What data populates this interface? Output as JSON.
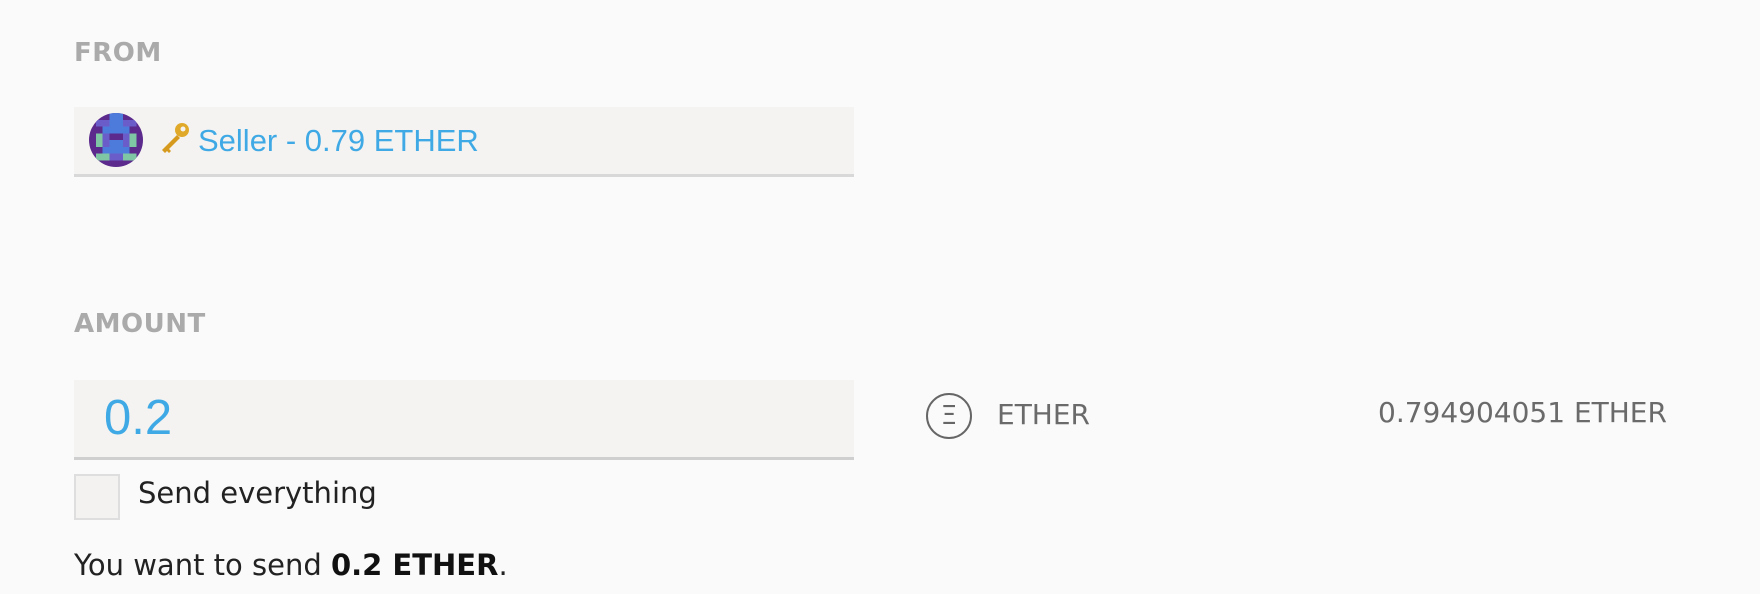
{
  "from": {
    "label": "FROM",
    "account_text": "Seller - 0.79 ETHER"
  },
  "amount": {
    "label": "AMOUNT",
    "value": "0.2",
    "currency_icon_glyph": "Ξ",
    "currency_name": "ETHER",
    "balance": "0.794904051 ETHER"
  },
  "send_everything": {
    "label": "Send everything",
    "checked": false
  },
  "summary": {
    "prefix": "You want to send ",
    "amount": "0.2 ETHER",
    "suffix": "."
  },
  "colors": {
    "accent": "#3fa9e5",
    "label_gray": "#aaaaaa",
    "field_bg": "#f4f3f1"
  },
  "icons": {
    "avatar": "identicon-avatar",
    "key": "key-icon",
    "currency": "ether-icon"
  }
}
